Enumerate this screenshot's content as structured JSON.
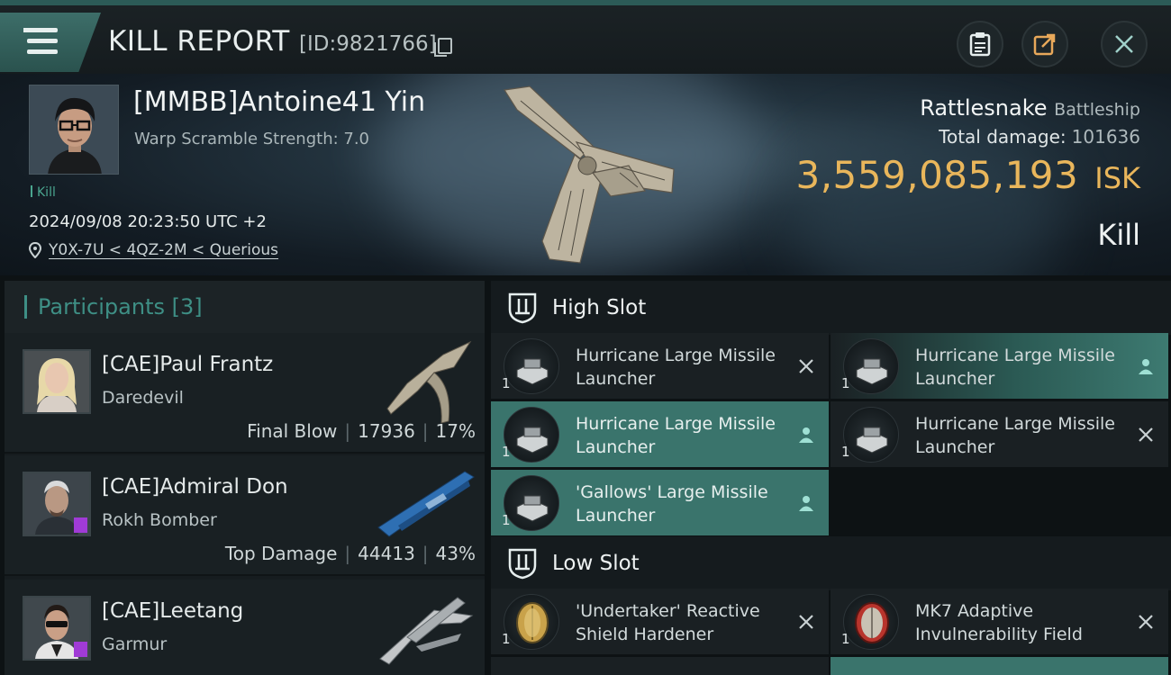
{
  "header": {
    "title": "KILL REPORT",
    "report_id": "[ID:9821766]"
  },
  "victim": {
    "name": "[MMBB]Antoine41 Yin",
    "warp_scramble": "Warp Scramble Strength: 7.0",
    "tag": "Kill",
    "datetime": "2024/09/08 20:23:50 UTC +2",
    "location": "Y0X-7U < 4QZ-2M < Querious",
    "ship_name": "Rattlesnake",
    "ship_class": "Battleship",
    "total_damage_label": "Total damage:",
    "total_damage_value": "101636",
    "isk_value": "3,559,085,193",
    "isk_unit": "ISK",
    "result": "Kill"
  },
  "participants": {
    "label": "Participants",
    "count": "[3]",
    "rows": [
      {
        "name": "[CAE]Paul Frantz",
        "ship": "Daredevil",
        "role": "Final Blow",
        "damage": "17936",
        "percent": "17%"
      },
      {
        "name": "[CAE]Admiral Don",
        "ship": "Rokh Bomber",
        "role": "Top Damage",
        "damage": "44413",
        "percent": "43%"
      },
      {
        "name": "[CAE]Leetang",
        "ship": "Garmur",
        "role": "",
        "damage": "",
        "percent": ""
      }
    ]
  },
  "slots": {
    "high": {
      "label": "High Slot",
      "modules": [
        {
          "name": "Hurricane Large Missile Launcher",
          "qty": "1",
          "state": "destroyed"
        },
        {
          "name": "Hurricane Large Missile Launcher",
          "qty": "1",
          "state": "dropped"
        },
        {
          "name": "Hurricane Large Missile Launcher",
          "qty": "1",
          "state": "dropped"
        },
        {
          "name": "Hurricane Large Missile Launcher",
          "qty": "1",
          "state": "destroyed"
        },
        {
          "name": "'Gallows' Large Missile Launcher",
          "qty": "1",
          "state": "dropped"
        }
      ]
    },
    "low": {
      "label": "Low Slot",
      "modules": [
        {
          "name": "'Undertaker' Reactive Shield Hardener",
          "qty": "1",
          "state": "destroyed"
        },
        {
          "name": "MK7 Adaptive Invulnerability Field",
          "qty": "1",
          "state": "destroyed"
        }
      ]
    }
  },
  "colors": {
    "accent": "#3e8f85",
    "isk": "#e9b65b",
    "dropped_bg": "#3a746c"
  },
  "icons": [
    "menu-icon",
    "copy-icon",
    "clipboard-icon",
    "share-icon",
    "close-icon",
    "location-pin-icon",
    "slot-icon",
    "person-icon",
    "x-icon"
  ]
}
